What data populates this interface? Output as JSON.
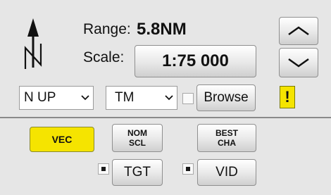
{
  "range": {
    "label": "Range:",
    "value": "5.8NM"
  },
  "scale": {
    "label": "Scale:",
    "value": "1:75 000"
  },
  "orientation": {
    "value": "N UP",
    "icon": "north-arrow-icon"
  },
  "motion": {
    "value": "TM"
  },
  "browse": {
    "label": "Browse",
    "checked": false
  },
  "alert": {
    "label": "!",
    "color": "#f5e400"
  },
  "range_buttons": {
    "up_icon": "chevron-up-icon",
    "down_icon": "chevron-down-icon"
  },
  "vec": {
    "label": "VEC",
    "color": "#f5e400"
  },
  "nom_scl": {
    "line1": "NOM",
    "line2": "SCL"
  },
  "best_cha": {
    "line1": "BEST",
    "line2": "CHA"
  },
  "tgt": {
    "label": "TGT",
    "checked": true
  },
  "vid": {
    "label": "VID",
    "checked": true
  }
}
